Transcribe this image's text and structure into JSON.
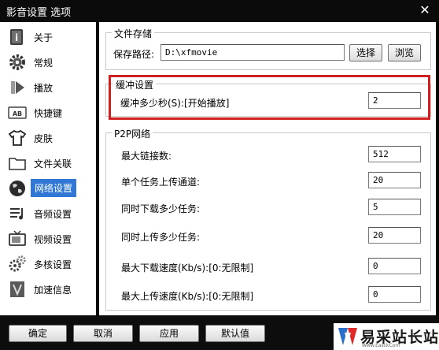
{
  "window": {
    "title": "影音设置 选项",
    "close_glyph": "✕"
  },
  "sidebar": {
    "items": [
      {
        "label": "关于",
        "icon": "about-icon"
      },
      {
        "label": "常规",
        "icon": "gear-icon"
      },
      {
        "label": "播放",
        "icon": "play-icon"
      },
      {
        "label": "快捷键",
        "icon": "keyboard-icon"
      },
      {
        "label": "皮肤",
        "icon": "shirt-icon"
      },
      {
        "label": "文件关联",
        "icon": "folder-icon"
      },
      {
        "label": "网络设置",
        "icon": "globe-icon",
        "selected": true
      },
      {
        "label": "音频设置",
        "icon": "audio-icon"
      },
      {
        "label": "视频设置",
        "icon": "tv-icon"
      },
      {
        "label": "多核设置",
        "icon": "multicore-icon"
      },
      {
        "label": "加速信息",
        "icon": "accelerate-icon"
      }
    ]
  },
  "file_storage": {
    "title": "文件存储",
    "path_label": "保存路径:",
    "path_value": "D:\\xfmovie",
    "select_button": "选择",
    "browse_button": "浏览"
  },
  "buffer": {
    "title": "缓冲设置",
    "label": "缓冲多少秒(S):[开始播放]",
    "value": "2"
  },
  "p2p": {
    "title": "P2P网络",
    "rows": [
      {
        "label": "最大链接数:",
        "value": "512"
      },
      {
        "label": "单个任务上传通道:",
        "value": "20"
      },
      {
        "label": "同时下载多少任务:",
        "value": "5"
      },
      {
        "label": "同时上传多少任务:",
        "value": "20"
      },
      {
        "label": "最大下载速度(Kb/s):[0:无限制]",
        "value": "0"
      },
      {
        "label": "最大上传速度(Kb/s):[0:无限制]",
        "value": "0"
      }
    ]
  },
  "footer": {
    "ok": "确定",
    "cancel": "取消",
    "apply": "应用",
    "default": "默认值"
  },
  "watermark": {
    "text": "易采站长站",
    "sub": "Www.EasckCom"
  },
  "colors": {
    "accent": "#3178d6",
    "highlight": "#d21f1f",
    "brand_blue": "#2a6fc9",
    "brand_red": "#e02a2a"
  }
}
